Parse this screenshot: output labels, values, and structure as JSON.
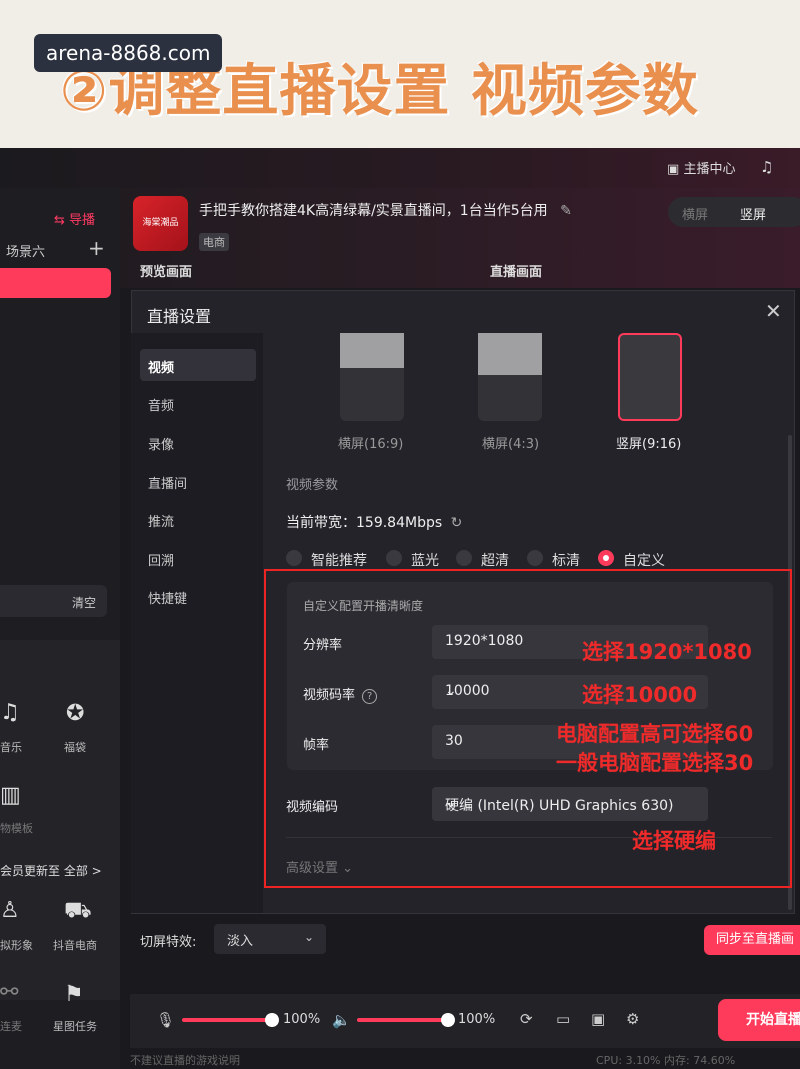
{
  "banner": {
    "site": "arena-8868.com",
    "headline": "②调整直播设置 视频参数"
  },
  "topbar": {
    "live_center": "主播中心"
  },
  "header": {
    "title": "手把手教你搭建4K高清绿幕/实景直播间，1台当作5台用",
    "tag": "电商",
    "thumb_text": "海棠潮品",
    "preview_label": "预览画面",
    "live_label": "直播画面",
    "orient_left": "横屏",
    "orient_right": "竖屏"
  },
  "sidebar": {
    "guide": "导播",
    "scene": "场景六",
    "clear": "清空",
    "tools": [
      {
        "icon": "music-icon",
        "label": "音乐"
      },
      {
        "icon": "gift-bag-icon",
        "label": "福袋"
      },
      {
        "icon": "chart-icon",
        "label": "物模板"
      },
      {
        "icon": "upgrade-icon",
        "label": "会员更新至 全部 >"
      },
      {
        "icon": "avatar-icon",
        "label": "拟形象"
      },
      {
        "icon": "cart-icon",
        "label": "抖音电商"
      },
      {
        "icon": "connect-icon",
        "label": "连麦"
      },
      {
        "icon": "task-icon",
        "label": "星图任务"
      }
    ]
  },
  "dialog": {
    "title": "直播设置",
    "nav": [
      "视频",
      "音频",
      "录像",
      "直播间",
      "推流",
      "回溯",
      "快捷键"
    ],
    "orientations": [
      {
        "label": "横屏(16:9)",
        "fill": 0.4
      },
      {
        "label": "横屏(4:3)",
        "fill": 0.48
      },
      {
        "label": "竖屏(9:16)",
        "fill": 0.0
      }
    ],
    "section_title": "视频参数",
    "bandwidth_label": "当前带宽：",
    "bandwidth_value": "159.84Mbps",
    "quality_options": [
      "智能推荐",
      "蓝光",
      "超清",
      "标清",
      "自定义"
    ],
    "quality_selected": "自定义",
    "custom_title": "自定义配置开播清晰度",
    "resolution_label": "分辨率",
    "resolution_value": "1920*1080",
    "bitrate_label": "视频码率",
    "bitrate_value": "10000",
    "framerate_label": "帧率",
    "framerate_value": "30",
    "encoder_label": "视频编码",
    "encoder_value": "硬编 (Intel(R) UHD Graphics 630)",
    "advanced": "高级设置"
  },
  "annotations": {
    "resolution_note": "选择1920*1080",
    "bitrate_note": "选择10000",
    "fps_note_1": "电脑配置高可选择60",
    "fps_note_2": "一般电脑配置选择30",
    "encoder_note": "选择硬编",
    "color": "#ef2a2a"
  },
  "bottom": {
    "switch_label": "切屏特效:",
    "switch_value": "淡入",
    "sync_button": "同步至直播画",
    "mic_level": "100%",
    "speaker_level": "100%",
    "start_button": "开始直播",
    "footer_left": "不建议直播的游戏说明",
    "footer_right": "CPU: 3.10%   内存: 74.60%"
  },
  "colors": {
    "accent": "#ff3b5c",
    "panel": "#24232a"
  }
}
